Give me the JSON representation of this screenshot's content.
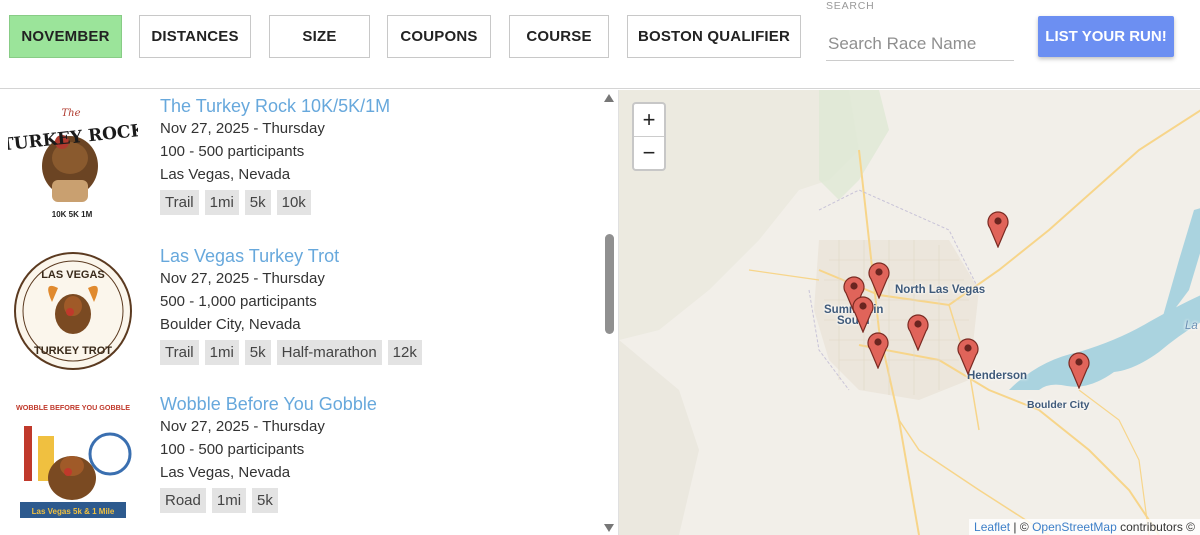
{
  "filters": [
    {
      "label": "NOVEMBER",
      "active": true
    },
    {
      "label": "DISTANCES",
      "active": false
    },
    {
      "label": "SIZE",
      "active": false
    },
    {
      "label": "COUPONS",
      "active": false
    },
    {
      "label": "COURSE",
      "active": false
    },
    {
      "label": "BOSTON QUALIFIER",
      "active": false
    }
  ],
  "search": {
    "label": "SEARCH",
    "placeholder": "Search Race Name",
    "value": ""
  },
  "list_button": "LIST YOUR RUN!",
  "races": [
    {
      "title": "The Turkey Rock 10K/5K/1M",
      "date": "Nov 27, 2025 - Thursday",
      "participants": "100 - 500 participants",
      "location": "Las Vegas, Nevada",
      "tags": [
        "Trail",
        "1mi",
        "5k",
        "10k"
      ],
      "logo_text": [
        "The",
        "TURKEY ROCK",
        "10K 5K 1M"
      ]
    },
    {
      "title": "Las Vegas Turkey Trot",
      "date": "Nov 27, 2025 - Thursday",
      "participants": "500 - 1,000 participants",
      "location": "Boulder City, Nevada",
      "tags": [
        "Trail",
        "1mi",
        "5k",
        "Half-marathon",
        "12k"
      ],
      "logo_text": [
        "LAS VEGAS",
        "TURKEY TROT"
      ]
    },
    {
      "title": "Wobble Before You Gobble",
      "date": "Nov 27, 2025 - Thursday",
      "participants": "100 - 500 participants",
      "location": "Las Vegas, Nevada",
      "tags": [
        "Road",
        "1mi",
        "5k"
      ],
      "logo_text": [
        "WOBBLE BEFORE YOU GOBBLE",
        "Las Vegas 5k & 1 Mile"
      ]
    }
  ],
  "map": {
    "zoom_in": "+",
    "zoom_out": "−",
    "labels": {
      "north_las_vegas": "North Las Vegas",
      "henderson": "Henderson",
      "boulder_city": "Boulder City",
      "summerlin": "Summerlin",
      "south": "South",
      "lake": "La"
    },
    "attribution": {
      "leaflet": "Leaflet",
      "sep": "| ©",
      "osm": "OpenStreetMap",
      "rest": "contributors ©"
    },
    "marker_count": 8
  },
  "colors": {
    "active_filter": "#9be49a",
    "list_button": "#6c8ff2",
    "race_title": "#67a8dc",
    "marker": "#e0645a"
  },
  "icons": {
    "scroll_up": "triangle-up-icon",
    "scroll_down": "triangle-down-icon",
    "marker": "map-pin-icon"
  }
}
